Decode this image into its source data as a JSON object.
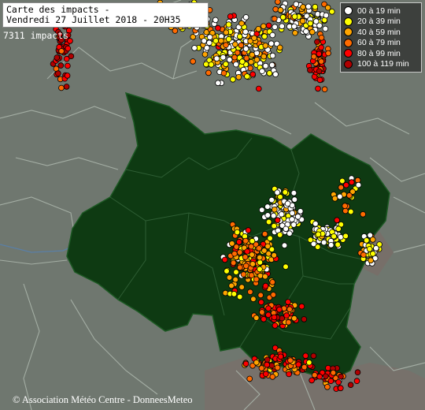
{
  "title": {
    "line1": "Carte des impacts -",
    "line2": "Vendredi 27 Juillet 2018 - 20H35"
  },
  "impact_count": "7311 impacts",
  "legend": {
    "items": [
      {
        "label": "00 à 19 min",
        "color": "#ffffff"
      },
      {
        "label": "20 à 39 min",
        "color": "#ffff00"
      },
      {
        "label": "40 à 59 min",
        "color": "#ffa500"
      },
      {
        "label": "60 à 79 min",
        "color": "#ff6a00"
      },
      {
        "label": "80 à 99 min",
        "color": "#ff0000"
      },
      {
        "label": "100 à 119 min",
        "color": "#b00000"
      }
    ]
  },
  "copyright": "© Association Météo Centre - DonneesMeteo",
  "colors": {
    "region_fill": "#0e3a12",
    "background": "#6f776f",
    "border": "#9aa59a",
    "river": "#5a7fa6"
  }
}
